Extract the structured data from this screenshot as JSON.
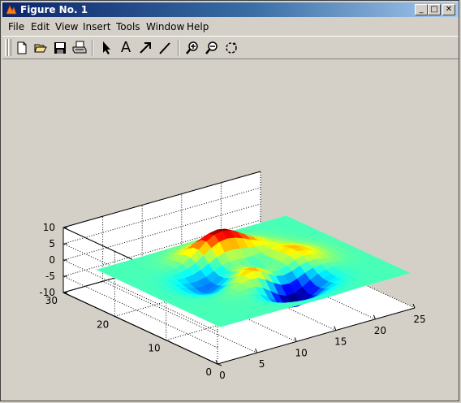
{
  "window": {
    "title": "Figure No. 1",
    "controls": {
      "minimize": "_",
      "restore": "□",
      "close": "✕"
    }
  },
  "menu": {
    "items": [
      "File",
      "Edit",
      "View",
      "Insert",
      "Tools",
      "Window",
      "Help"
    ]
  },
  "toolbar": {
    "tools": [
      {
        "name": "new-figure-icon"
      },
      {
        "name": "open-file-icon"
      },
      {
        "name": "save-icon"
      },
      {
        "name": "print-icon"
      },
      {
        "name": "edit-plot-arrow-icon"
      },
      {
        "name": "insert-text-icon",
        "label": "A"
      },
      {
        "name": "insert-arrow-icon"
      },
      {
        "name": "insert-line-icon"
      },
      {
        "name": "zoom-in-icon"
      },
      {
        "name": "zoom-out-icon"
      },
      {
        "name": "rotate-3d-icon"
      }
    ]
  },
  "chart_data": {
    "type": "surface",
    "function": "peaks",
    "colormap": "jet",
    "grid": true,
    "x_ticks": [
      "0",
      "5",
      "10",
      "15",
      "20",
      "25"
    ],
    "y_ticks": [
      "0",
      "10",
      "20",
      "30"
    ],
    "z_ticks": [
      "-10",
      "-5",
      "0",
      "5",
      "10"
    ],
    "xlim": [
      0,
      25
    ],
    "ylim": [
      0,
      30
    ],
    "zlim": [
      -10,
      10
    ],
    "surface_x_range": [
      1,
      25
    ],
    "surface_y_range": [
      1,
      25
    ],
    "color_range": [
      -6.5,
      8.1
    ]
  }
}
